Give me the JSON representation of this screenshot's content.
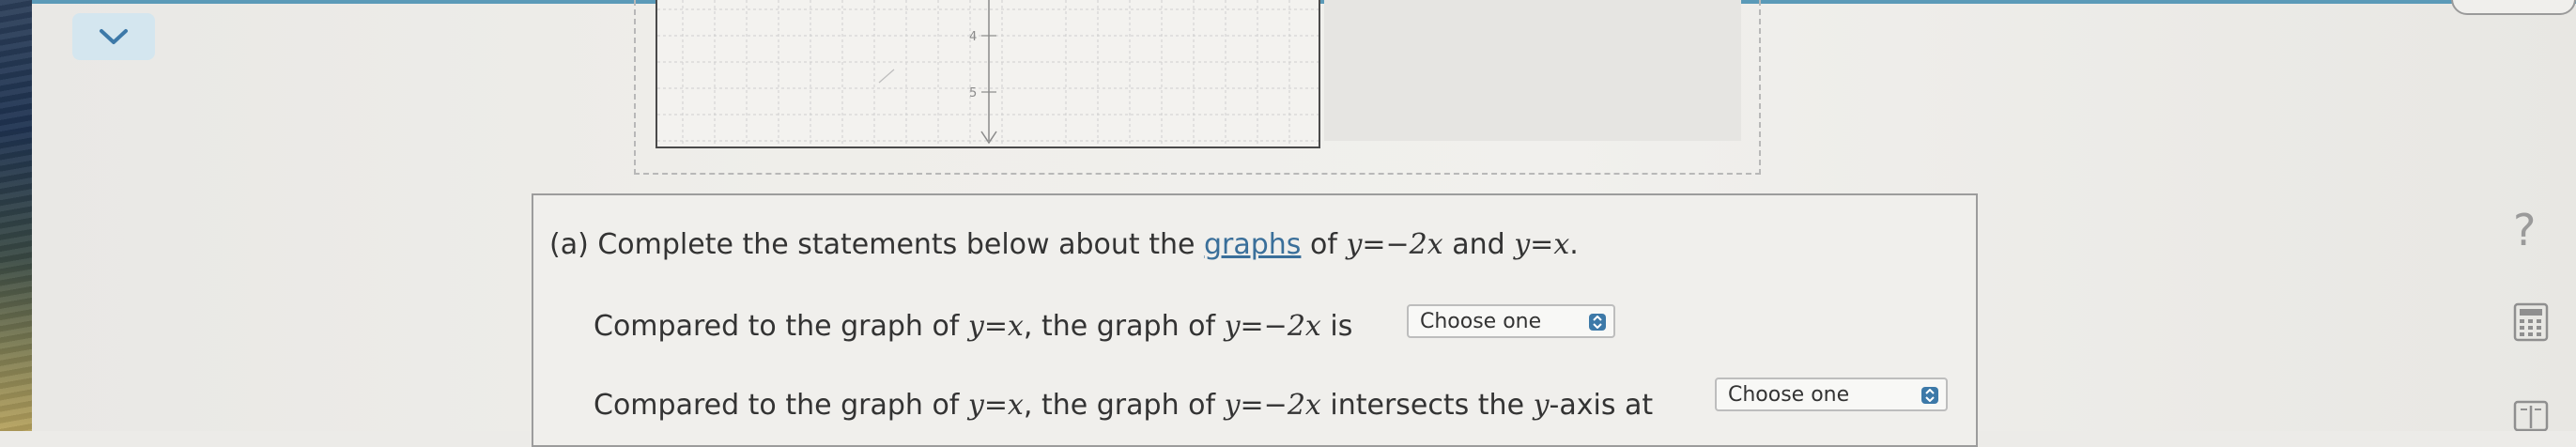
{
  "theme": {
    "accent": "#3d79a8",
    "link": "#3a6f9a",
    "top_bar": "#5b9ab8"
  },
  "header": {
    "collapse_icon": "chevron-down-icon"
  },
  "graph": {
    "tick_labels": [
      "4",
      "5"
    ]
  },
  "question": {
    "part": "(a)",
    "prefix": "Complete the statements below about the",
    "link_text": "graphs",
    "of": "of",
    "eq1": "y=−2x",
    "and": "and",
    "eq2": "y=x",
    "period": "."
  },
  "statement1": {
    "prefix": "Compared to the graph of",
    "eq_a": "y=x",
    "comma": ", the graph of",
    "eq_b": "y=−2x",
    "suffix": "is",
    "select_value": "Choose one"
  },
  "statement2": {
    "prefix": "Compared to the graph of",
    "eq_a": "y=x",
    "comma": ", the graph of",
    "eq_b": "y=−2x",
    "mid": "intersects the",
    "axis_var": "y",
    "suffix": "-axis at",
    "select_value": "Choose one"
  },
  "tools": {
    "help_label": "?",
    "help_icon": "help-icon",
    "calculator_icon": "calculator-icon",
    "reference_icon": "book-icon"
  }
}
